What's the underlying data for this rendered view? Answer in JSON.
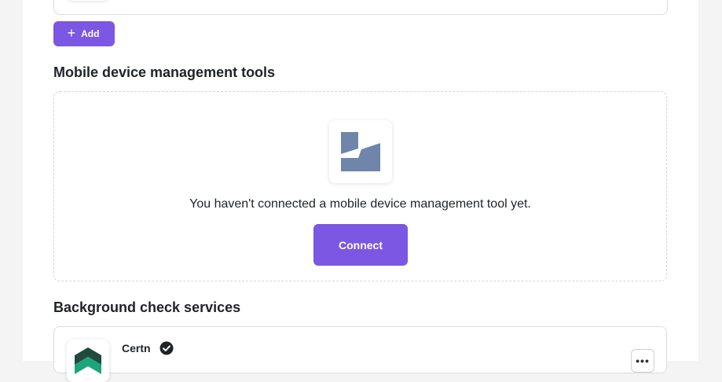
{
  "add_button": {
    "label": "Add",
    "icon": "plus-icon"
  },
  "mdm": {
    "title": "Mobile device management tools",
    "empty_message": "You haven't connected a mobile device management tool yet.",
    "connect_label": "Connect",
    "icon": "mdm-tool-icon"
  },
  "background_checks": {
    "title": "Background check services",
    "items": [
      {
        "name": "Certn",
        "verified_icon": "check-circle-icon",
        "logo": "certn-logo",
        "menu_icon": "ellipsis-icon"
      }
    ]
  },
  "colors": {
    "accent": "#7b57e3",
    "mdm_logo": "#6f86aa",
    "certn_green": "#1aa57a",
    "certn_dark": "#1f4a3d"
  }
}
